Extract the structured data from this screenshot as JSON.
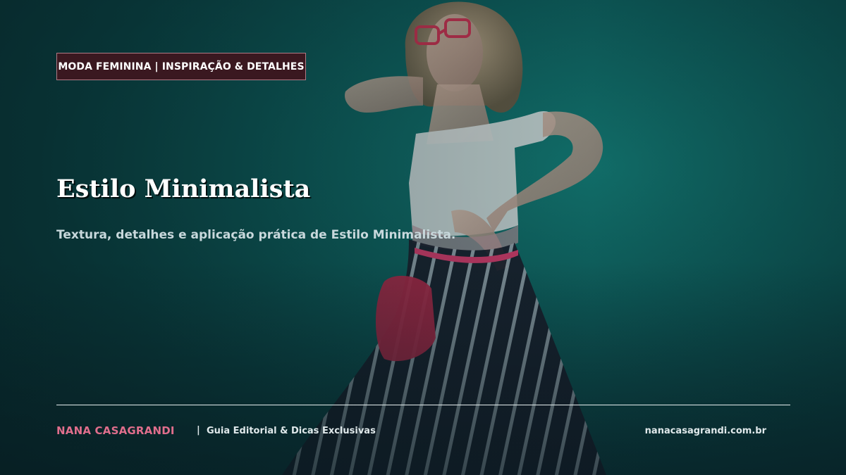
{
  "header": {
    "category": "MODA FEMININA | INSPIRAÇÃO & DETALHES"
  },
  "main": {
    "title": "Estilo Minimalista",
    "subtitle": "Textura, detalhes e aplicação prática de Estilo Minimalista."
  },
  "footer": {
    "brand": "NANA CASAGRANDI",
    "separator": "|",
    "tagline": "Guia Editorial & Dicas Exclusivas",
    "website": "nanacasagrandi.com.br"
  },
  "colors": {
    "background_teal": "#0e5e5c",
    "badge_background": "#3a1820",
    "badge_border": "#b07a85",
    "brand_pink": "#e06e8c",
    "title_white": "#ffffff",
    "subtitle_grey": "#c8d8dc"
  }
}
